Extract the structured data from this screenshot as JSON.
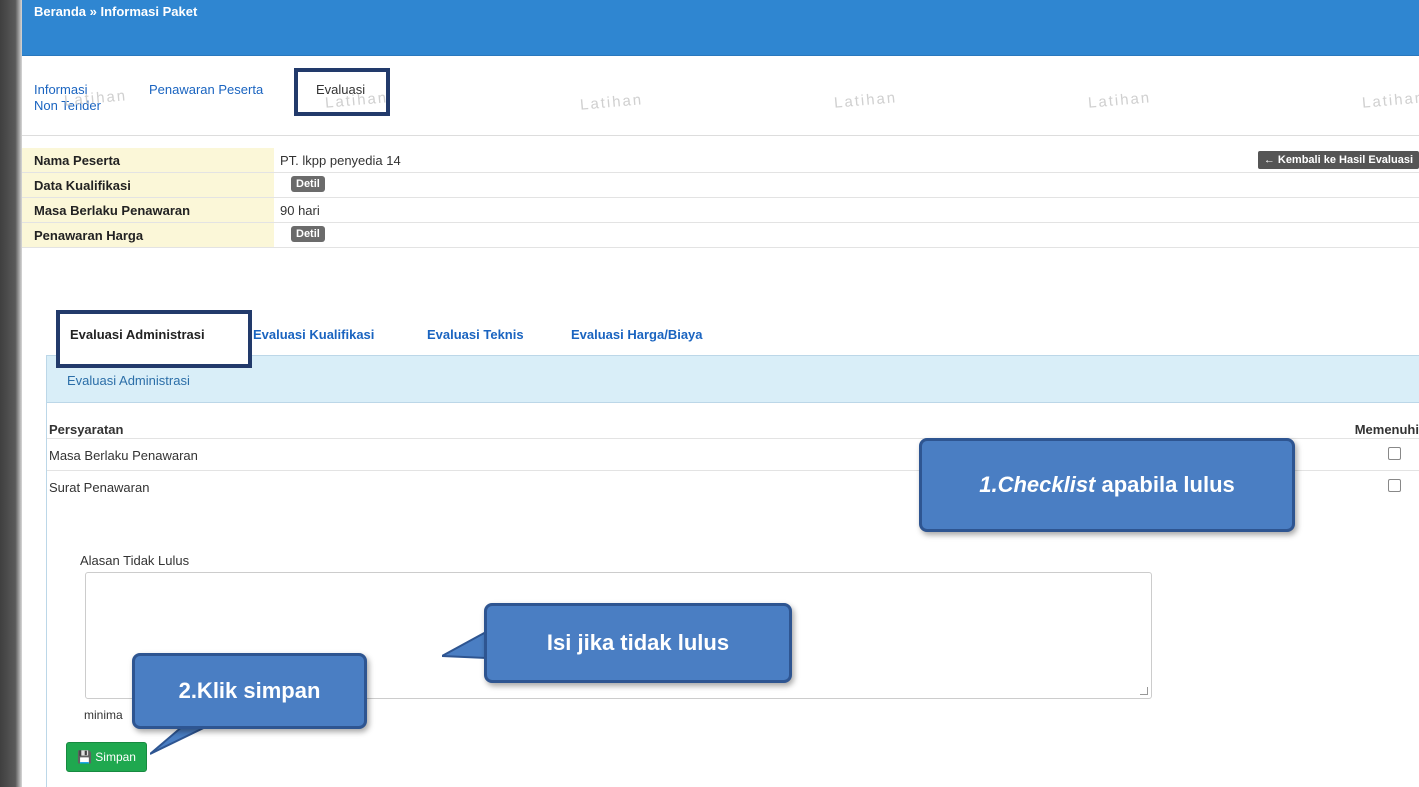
{
  "breadcrumb": "Beranda » Informasi Paket",
  "nav": {
    "informasi": "Informasi Non Tender",
    "penawaran": "Penawaran Peserta",
    "evaluasi": "Evaluasi"
  },
  "watermark": "Latihan",
  "info": {
    "nama_peserta_label": "Nama Peserta",
    "nama_peserta_value": "PT. lkpp penyedia 14",
    "data_kualifikasi_label": "Data Kualifikasi",
    "masa_berlaku_label": "Masa Berlaku Penawaran",
    "masa_berlaku_value": "90 hari",
    "penawaran_harga_label": "Penawaran Harga",
    "detil_label": "Detil",
    "back_button": "← Kembali ke Hasil Evaluasi"
  },
  "eval_tabs": {
    "administrasi": "Evaluasi Administrasi",
    "kualifikasi": "Evaluasi Kualifikasi",
    "teknis": "Evaluasi Teknis",
    "harga": "Evaluasi Harga/Biaya"
  },
  "panel": {
    "title": "Evaluasi Administrasi",
    "col_persyaratan": "Persyaratan",
    "col_memenuhi": "Memenuhi",
    "rows": [
      "Masa Berlaku Penawaran",
      "Surat Penawaran"
    ],
    "alasan_label": "Alasan Tidak Lulus",
    "minimal_text": "minima",
    "simpan_button": "Simpan"
  },
  "callouts": {
    "checklist_italic": "1.Checklist",
    "checklist_rest": " apabila lulus",
    "isi": "Isi jika tidak lulus",
    "klik": "2.Klik simpan"
  },
  "colors": {
    "topbar": "#2f86d1",
    "callout": "#4a7ec3",
    "simpan": "#1fa84f"
  }
}
